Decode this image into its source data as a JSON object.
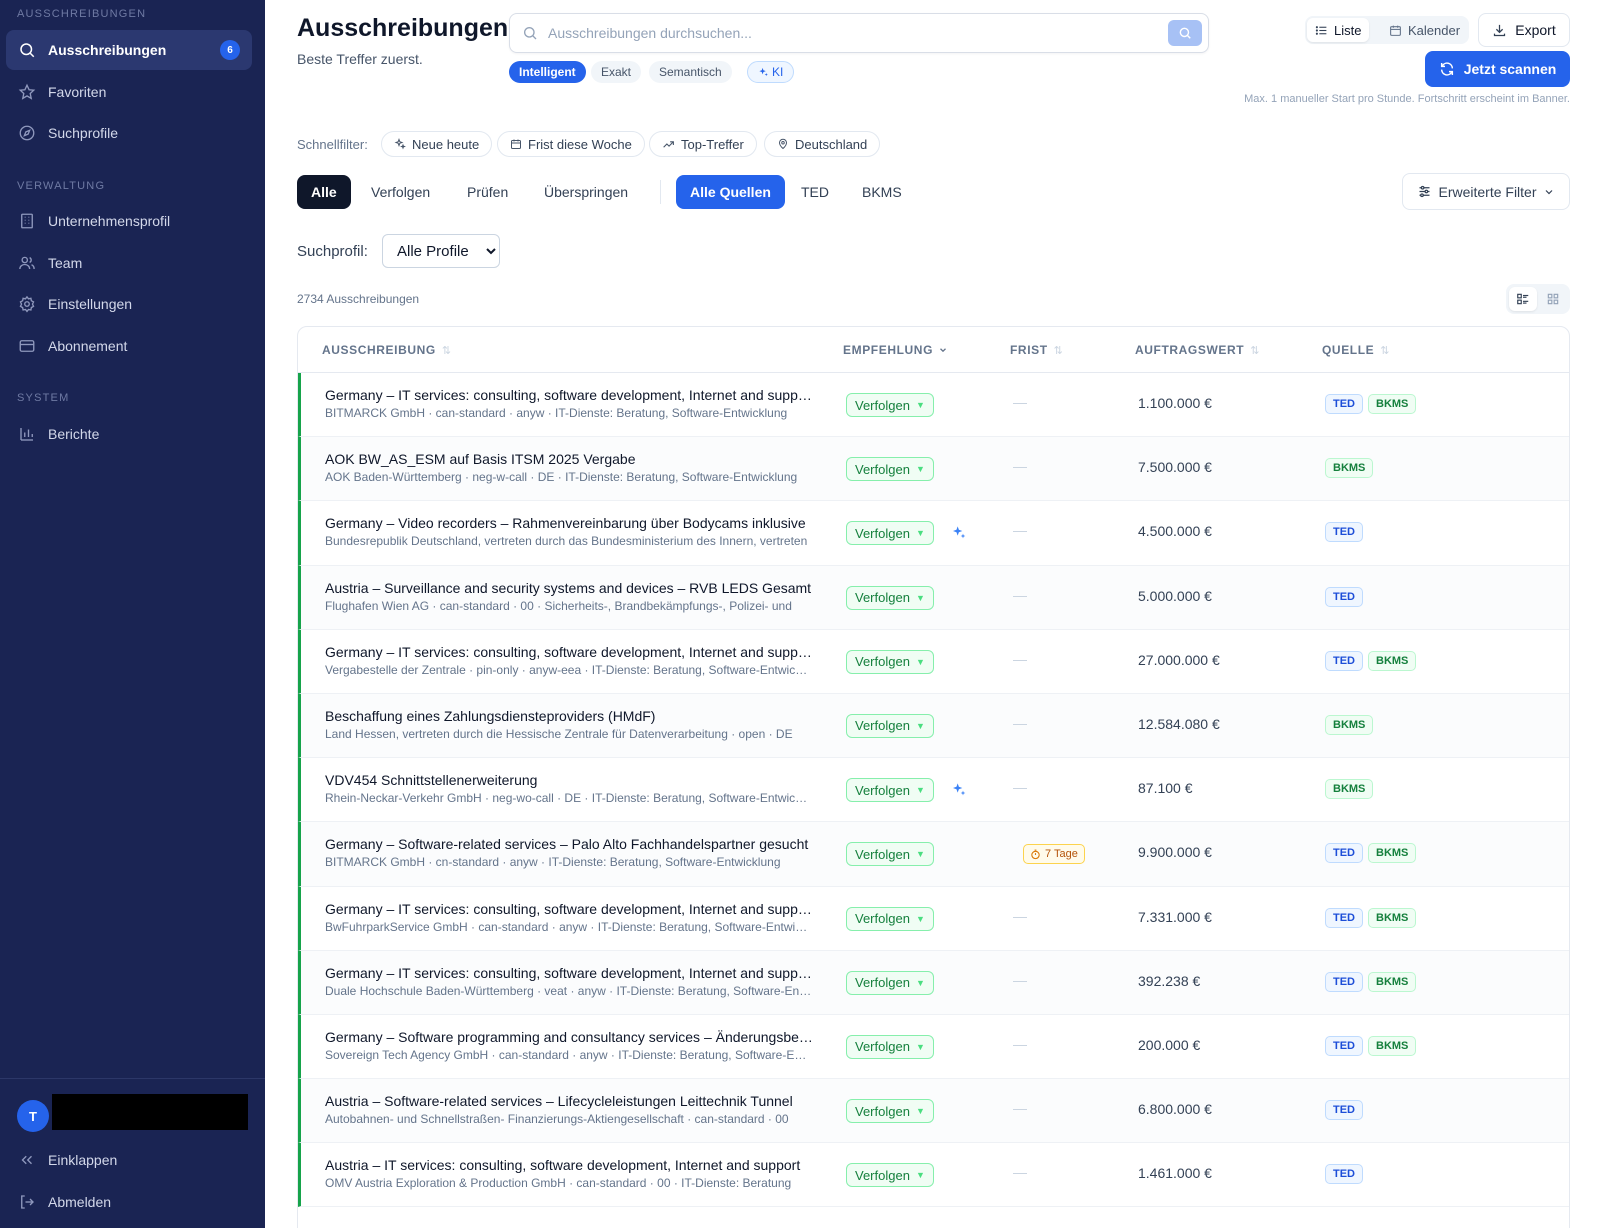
{
  "sidebar": {
    "sections": {
      "tenders": "AUSSCHREIBUNGEN",
      "admin": "VERWALTUNG",
      "system": "SYSTEM"
    },
    "items": [
      {
        "label": "Ausschreibungen",
        "badge": "6"
      },
      {
        "label": "Favoriten"
      },
      {
        "label": "Suchprofile"
      },
      {
        "label": "Unternehmensprofil"
      },
      {
        "label": "Team"
      },
      {
        "label": "Einstellungen"
      },
      {
        "label": "Abonnement"
      },
      {
        "label": "Berichte"
      }
    ],
    "user_initial": "T",
    "collapse_label": "Einklappen",
    "logout_label": "Abmelden"
  },
  "header": {
    "title": "Ausschreibungen",
    "subtitle": "Beste Treffer zuerst.",
    "search_placeholder": "Ausschreibungen durchsuchen...",
    "search_modes": [
      "Intelligent",
      "Exakt",
      "Semantisch",
      "KI"
    ],
    "view_list": "Liste",
    "view_calendar": "Kalender",
    "export_label": "Export",
    "scan_label": "Jetzt scannen",
    "scan_hint": "Max. 1 manueller Start pro Stunde. Fortschritt erscheint im Banner."
  },
  "quick_filters": {
    "label": "Schnellfilter:",
    "chips": [
      "Neue heute",
      "Frist diese Woche",
      "Top-Treffer",
      "Deutschland"
    ]
  },
  "tabs": {
    "status": [
      "Alle",
      "Verfolgen",
      "Prüfen",
      "Überspringen"
    ],
    "sources": [
      "Alle Quellen",
      "TED",
      "BKMS"
    ],
    "advanced_filter": "Erweiterte Filter"
  },
  "profile": {
    "label": "Suchprofil:",
    "selected": "Alle Profile"
  },
  "result_count": "2734 Ausschreibungen",
  "table": {
    "columns": [
      "AUSSCHREIBUNG",
      "EMPFEHLUNG",
      "FRIST",
      "AUFTRAGSWERT",
      "QUELLE"
    ],
    "rows": [
      {
        "title": "Germany – IT services: consulting, software development, Internet and support",
        "sub": "BITMARCK GmbH · can-standard · anyw · IT-Dienste: Beratung, Software-Entwicklung",
        "rec": "Verfolgen",
        "deadline": "—",
        "value": "1.100.000 €",
        "sources": [
          "TED",
          "BKMS"
        ]
      },
      {
        "title": "AOK BW_AS_ESM auf Basis ITSM 2025 Vergabe",
        "sub": "AOK Baden-Württemberg · neg-w-call · DE · IT-Dienste: Beratung, Software-Entwicklung",
        "rec": "Verfolgen",
        "deadline": "—",
        "value": "7.500.000 €",
        "sources": [
          "BKMS"
        ]
      },
      {
        "title": "Germany – Video recorders – Rahmenvereinbarung über Bodycams inklusive",
        "sub": "Bundesrepublik Deutschland, vertreten durch das Bundesministerium des Innern, vertreten",
        "rec": "Verfolgen",
        "ai": true,
        "deadline": "—",
        "value": "4.500.000 €",
        "sources": [
          "TED"
        ]
      },
      {
        "title": "Austria – Surveillance and security systems and devices – RVB LEDS Gesamt",
        "sub": "Flughafen Wien AG · can-standard · 00 · Sicherheits-, Brandbekämpfungs-, Polizei- und",
        "rec": "Verfolgen",
        "deadline": "—",
        "value": "5.000.000 €",
        "sources": [
          "TED"
        ]
      },
      {
        "title": "Germany – IT services: consulting, software development, Internet and support",
        "sub": "Vergabestelle der Zentrale · pin-only · anyw-eea · IT-Dienste: Beratung, Software-Entwicklung",
        "rec": "Verfolgen",
        "deadline": "—",
        "value": "27.000.000 €",
        "sources": [
          "TED",
          "BKMS"
        ]
      },
      {
        "title": "Beschaffung eines Zahlungsdiensteproviders (HMdF)",
        "sub": "Land Hessen, vertreten durch die Hessische Zentrale für Datenverarbeitung · open · DE",
        "rec": "Verfolgen",
        "deadline": "—",
        "value": "12.584.080 €",
        "sources": [
          "BKMS"
        ]
      },
      {
        "title": "VDV454 Schnittstellenerweiterung",
        "sub": "Rhein-Neckar-Verkehr GmbH · neg-wo-call · DE · IT-Dienste: Beratung, Software-Entwicklung",
        "rec": "Verfolgen",
        "ai": true,
        "deadline": "—",
        "value": "87.100 €",
        "sources": [
          "BKMS"
        ]
      },
      {
        "title": "Germany – Software-related services – Palo Alto Fachhandelspartner gesucht",
        "sub": "BITMARCK GmbH · cn-standard · anyw · IT-Dienste: Beratung, Software-Entwicklung",
        "rec": "Verfolgen",
        "deadline": "7 Tage",
        "value": "9.900.000 €",
        "sources": [
          "TED",
          "BKMS"
        ]
      },
      {
        "title": "Germany – IT services: consulting, software development, Internet and support",
        "sub": "BwFuhrparkService GmbH · can-standard · anyw · IT-Dienste: Beratung, Software-Entwicklung",
        "rec": "Verfolgen",
        "deadline": "—",
        "value": "7.331.000 €",
        "sources": [
          "TED",
          "BKMS"
        ]
      },
      {
        "title": "Germany – IT services: consulting, software development, Internet and support",
        "sub": "Duale Hochschule Baden-Württemberg · veat · anyw · IT-Dienste: Beratung, Software-Entwicklung",
        "rec": "Verfolgen",
        "deadline": "—",
        "value": "392.238 €",
        "sources": [
          "TED",
          "BKMS"
        ]
      },
      {
        "title": "Germany – Software programming and consultancy services – Änderungsbekanntmachung",
        "sub": "Sovereign Tech Agency GmbH · can-standard · anyw · IT-Dienste: Beratung, Software-Entwicklung",
        "rec": "Verfolgen",
        "deadline": "—",
        "value": "200.000 €",
        "sources": [
          "TED",
          "BKMS"
        ]
      },
      {
        "title": "Austria – Software-related services – Lifecycleleistungen Leittechnik Tunnel",
        "sub": "Autobahnen- und Schnellstraßen- Finanzierungs-Aktiengesellschaft · can-standard · 00",
        "rec": "Verfolgen",
        "deadline": "—",
        "value": "6.800.000 €",
        "sources": [
          "TED"
        ]
      },
      {
        "title": "Austria – IT services: consulting, software development, Internet and support",
        "sub": "OMV Austria Exploration & Production GmbH · can-standard · 00 · IT-Dienste: Beratung",
        "rec": "Verfolgen",
        "deadline": "—",
        "value": "1.461.000 €",
        "sources": [
          "TED"
        ]
      }
    ]
  }
}
